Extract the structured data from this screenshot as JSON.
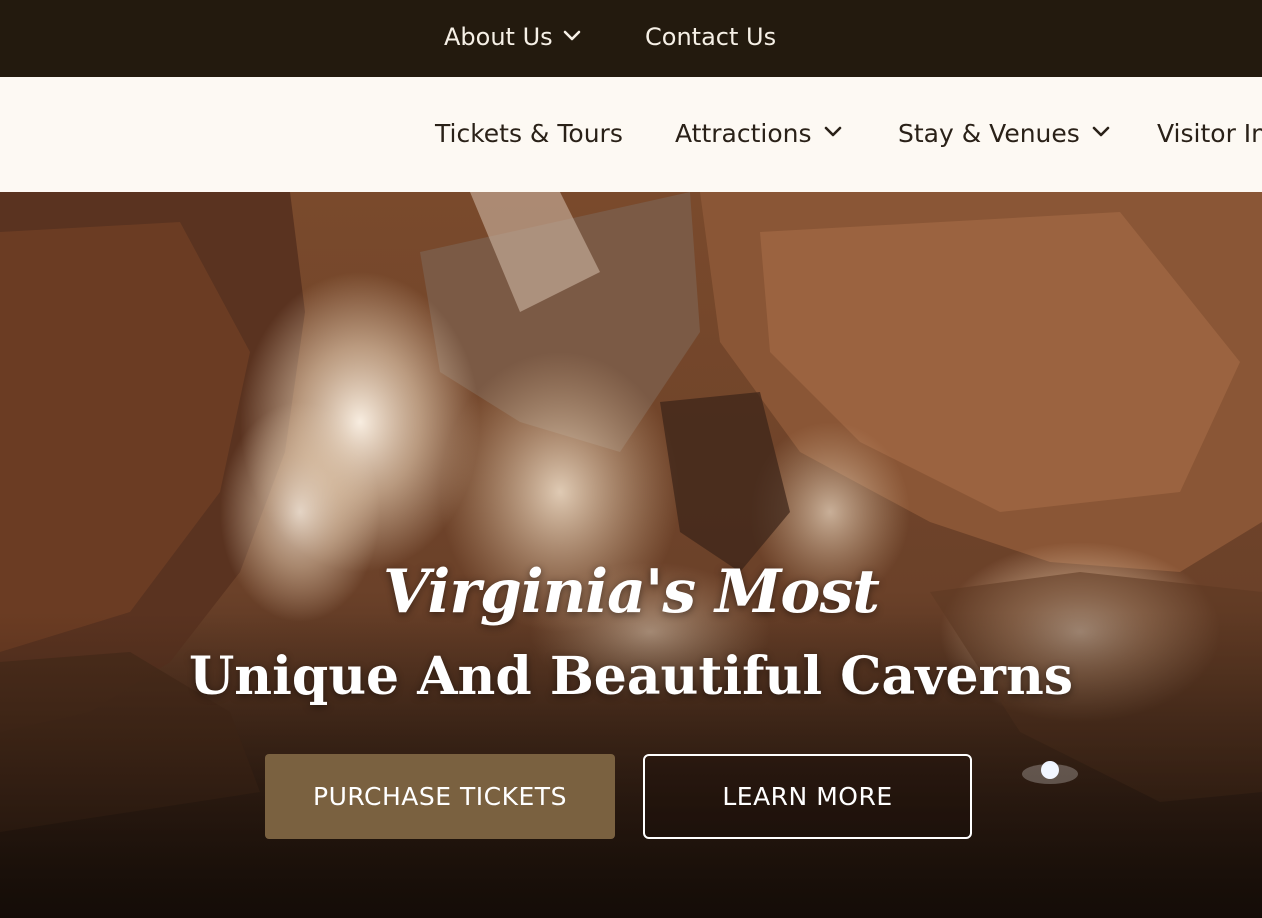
{
  "utility_nav": {
    "about_label": "About Us",
    "contact_label": "Contact Us"
  },
  "main_nav": {
    "items": [
      {
        "label": "Tickets & Tours",
        "has_dropdown": false
      },
      {
        "label": "Attractions",
        "has_dropdown": true
      },
      {
        "label": "Stay & Venues",
        "has_dropdown": true
      },
      {
        "label": "Visitor Inf",
        "has_dropdown": false
      }
    ]
  },
  "hero": {
    "script_heading": "Virginia's Most",
    "title": "Unique And Beautiful Caverns",
    "primary_button": "PURCHASE TICKETS",
    "secondary_button": "LEARN MORE"
  },
  "colors": {
    "topbar_bg": "#231a0e",
    "nav_bg": "#fdf9f3",
    "primary_button": "#7a6140",
    "hero_text": "#ffffff"
  },
  "icons": {
    "dropdown": "chevron-down-icon"
  }
}
